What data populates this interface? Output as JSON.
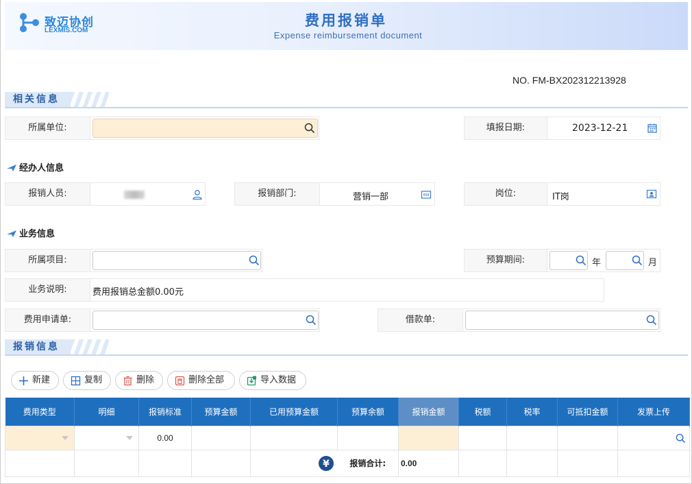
{
  "header": {
    "logo_cn": "致迈协创",
    "logo_en": "LEXMIS.COM",
    "title": "费用报销单",
    "subtitle": "Expense reimbursement document"
  },
  "doc_no": "NO.  FM-BX202312213928",
  "sections": {
    "related": "相关信息",
    "reimburse": "报销信息"
  },
  "related": {
    "unit_label": "所属单位:",
    "unit_value": "",
    "date_label": "填报日期:",
    "date_value": "2023-12-21"
  },
  "handler": {
    "heading": "经办人信息",
    "person_label": "报销人员:",
    "person_value": "",
    "dept_label": "报销部门:",
    "dept_value": "营销一部",
    "post_label": "岗位:",
    "post_value": "IT岗"
  },
  "business": {
    "heading": "业务信息",
    "project_label": "所属项目:",
    "project_value": "",
    "period_label": "预算期间:",
    "year_unit": "年",
    "month_unit": "月",
    "desc_label": "业务说明:",
    "desc_value": "费用报销总金额0.00元",
    "apply_label": "费用申请单:",
    "apply_value": "",
    "loan_label": "借款单:",
    "loan_value": ""
  },
  "toolbar": {
    "add": "新建",
    "copy": "复制",
    "delete": "删除",
    "delete_all": "删除全部",
    "import": "导入数据"
  },
  "table": {
    "headers": [
      "费用类型",
      "明细",
      "报销标准",
      "预算金额",
      "已用预算金额",
      "预算余额",
      "报销金额",
      "税额",
      "税率",
      "可抵扣金额",
      "发票上传"
    ],
    "row": {
      "standard": "0.00"
    },
    "total_label": "报销合计:",
    "total_value": "0.00"
  },
  "colors": {
    "brand_blue": "#1f6fbf",
    "required_fill": "#fdefd6",
    "title_blue": "#2f6fc4"
  }
}
